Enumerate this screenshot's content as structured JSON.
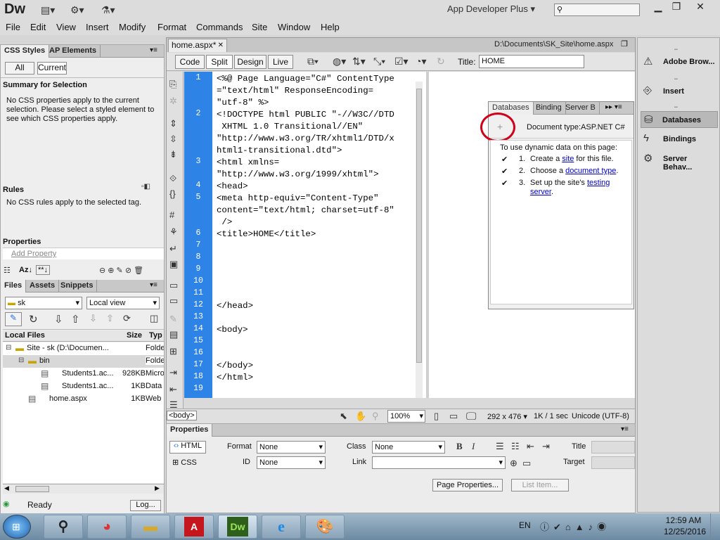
{
  "app": {
    "logo": "Dw",
    "workspace": "App Developer Plus"
  },
  "menu": [
    "File",
    "Edit",
    "View",
    "Insert",
    "Modify",
    "Format",
    "Commands",
    "Site",
    "Window",
    "Help"
  ],
  "left": {
    "css_tabs": [
      "CSS Styles",
      "AP Elements"
    ],
    "all_label": "All",
    "current_label": "Current",
    "summary_title": "Summary for Selection",
    "summary_text": "No CSS properties apply to the current selection.  Please select a styled element to see which CSS properties apply.",
    "rules_title": "Rules",
    "rules_text": "No CSS rules apply to the selected tag.",
    "properties_title": "Properties",
    "add_property": "Add Property",
    "az_label": "Az↓",
    "star_label": "**↓",
    "files_tabs": [
      "Files",
      "Assets",
      "Snippets"
    ],
    "site_select": "sk",
    "view_select": "Local view",
    "file_headers": {
      "local": "Local Files",
      "size": "Size",
      "type": "Typ"
    },
    "files": [
      {
        "name": "Site - sk (D:\\Documen...",
        "size": "",
        "type": "Folde",
        "indent": 0,
        "kind": "site"
      },
      {
        "name": "bin",
        "size": "",
        "type": "Folde",
        "indent": 1,
        "kind": "folder"
      },
      {
        "name": "Students1.ac...",
        "size": "928KB",
        "type": "Micro",
        "indent": 2,
        "kind": "file"
      },
      {
        "name": "Students1.ac...",
        "size": "1KB",
        "type": "Data",
        "indent": 2,
        "kind": "file"
      },
      {
        "name": "home.aspx",
        "size": "1KB",
        "type": "Web",
        "indent": 1,
        "kind": "file"
      }
    ],
    "status": "Ready",
    "log_button": "Log..."
  },
  "doc": {
    "tab": "home.aspx*",
    "path": "D:\\Documents\\SK_Site\\home.aspx",
    "views": [
      "Code",
      "Split",
      "Design",
      "Live"
    ],
    "title_label": "Title:",
    "title_value": "HOME",
    "lines": [
      {
        "n": "1",
        "text": "<%@ Page Language=\"C#\" ContentType\n=\"text/html\" ResponseEncoding=\n\"utf-8\" %>"
      },
      {
        "n": "2",
        "text": "<!DOCTYPE html PUBLIC \"-//W3C//DTD\n XHTML 1.0 Transitional//EN\"\n\"http://www.w3.org/TR/xhtml1/DTD/x\nhtml1-transitional.dtd\">"
      },
      {
        "n": "3",
        "text": "<html xmlns=\n\"http://www.w3.org/1999/xhtml\">"
      },
      {
        "n": "4",
        "text": "<head>"
      },
      {
        "n": "5",
        "text": "<meta http-equiv=\"Content-Type\"\ncontent=\"text/html; charset=utf-8\"\n />"
      },
      {
        "n": "6",
        "text": "<title>HOME</title>"
      },
      {
        "n": "7",
        "text": ""
      },
      {
        "n": "8",
        "text": ""
      },
      {
        "n": "9",
        "text": ""
      },
      {
        "n": "10",
        "text": ""
      },
      {
        "n": "11",
        "text": ""
      },
      {
        "n": "12",
        "text": "</head>"
      },
      {
        "n": "13",
        "text": ""
      },
      {
        "n": "14",
        "text": "<body>"
      },
      {
        "n": "15",
        "text": ""
      },
      {
        "n": "16",
        "text": ""
      },
      {
        "n": "17",
        "text": "</body>"
      },
      {
        "n": "18",
        "text": "</html>"
      },
      {
        "n": "19",
        "text": ""
      }
    ],
    "tag_selector": "<body>",
    "zoom": "100%",
    "dimensions": "292 x 476",
    "filesize": "1K / 1 sec",
    "encoding": "Unicode (UTF-8)"
  },
  "db_panel": {
    "tabs": [
      "Databases",
      "Binding",
      "Server B"
    ],
    "doc_type": "Document type:ASP.NET C#",
    "intro": "To use dynamic data on this page:",
    "steps": [
      {
        "num": "1.",
        "pre": "Create a ",
        "link": "site",
        "post": " for this file."
      },
      {
        "num": "2.",
        "pre": "Choose a ",
        "link": "document type",
        "post": "."
      },
      {
        "num": "3.",
        "pre": "Set up the site's ",
        "link": "testing server",
        "post": "."
      }
    ]
  },
  "right_panel": [
    "Adobe Brow...",
    "Insert",
    "Databases",
    "Bindings",
    "Server Behav..."
  ],
  "props": {
    "title": "Properties",
    "html": "HTML",
    "css": "CSS",
    "format_label": "Format",
    "format_value": "None",
    "id_label": "ID",
    "id_value": "None",
    "class_label": "Class",
    "class_value": "None",
    "link_label": "Link",
    "title_label": "Title",
    "target_label": "Target",
    "page_props": "Page Properties...",
    "list_item": "List Item..."
  },
  "taskbar": {
    "lang": "EN",
    "time": "12:59 AM",
    "date": "12/25/2016"
  },
  "colors": {
    "gutter": "#2d84e6",
    "highlight": "#d0021b"
  }
}
